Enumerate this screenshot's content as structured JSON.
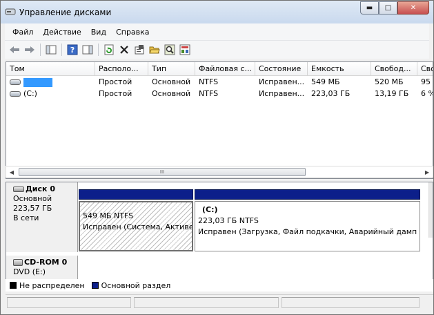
{
  "window": {
    "title": "Управление дисками",
    "controls": {
      "minimize": "▬",
      "maximize": "□",
      "close": "✕"
    }
  },
  "menu": [
    "Файл",
    "Действие",
    "Вид",
    "Справка"
  ],
  "toolbar": {
    "buttons": [
      "back-arrow-icon",
      "forward-arrow-icon",
      "show-pane-icon",
      "help-icon",
      "properties-pane-icon",
      "refresh-icon",
      "delete-icon",
      "properties-icon",
      "open-folder-icon",
      "search-icon",
      "settings-icon"
    ]
  },
  "volume_list": {
    "columns": [
      "Том",
      "Располо...",
      "Тип",
      "Файловая с...",
      "Состояние",
      "Емкость",
      "Свобод...",
      "Сво"
    ],
    "rows": [
      {
        "name": "",
        "layout": "Простой",
        "type": "Основной",
        "fs": "NTFS",
        "status": "Исправен...",
        "capacity": "549 МБ",
        "free": "520 МБ",
        "pct": "95"
      },
      {
        "name": "(C:)",
        "layout": "Простой",
        "type": "Основной",
        "fs": "NTFS",
        "status": "Исправен...",
        "capacity": "223,03 ГБ",
        "free": "13,19 ГБ",
        "pct": "6 %"
      }
    ],
    "scroll_thumb": "III"
  },
  "disks": [
    {
      "name": "Диск 0",
      "type": "Основной",
      "size": "223,57 ГБ",
      "state": "В сети",
      "partitions": [
        {
          "label": "",
          "line1": "549 МБ NTFS",
          "line2": "Исправен (Система, Активе"
        },
        {
          "label": "(C:)",
          "line1": "223,03 ГБ NTFS",
          "line2": "Исправен (Загрузка, Файл подкачки, Аварийный дамп па"
        }
      ]
    },
    {
      "name": "CD-ROM 0",
      "type": "DVD (E:)"
    }
  ],
  "legend": [
    {
      "label": "Не распределен",
      "color": "#000000"
    },
    {
      "label": "Основной раздел",
      "color": "#0c1f8a"
    }
  ],
  "colors": {
    "selection": "#3399ff",
    "primary_partition": "#0c1f8a"
  }
}
